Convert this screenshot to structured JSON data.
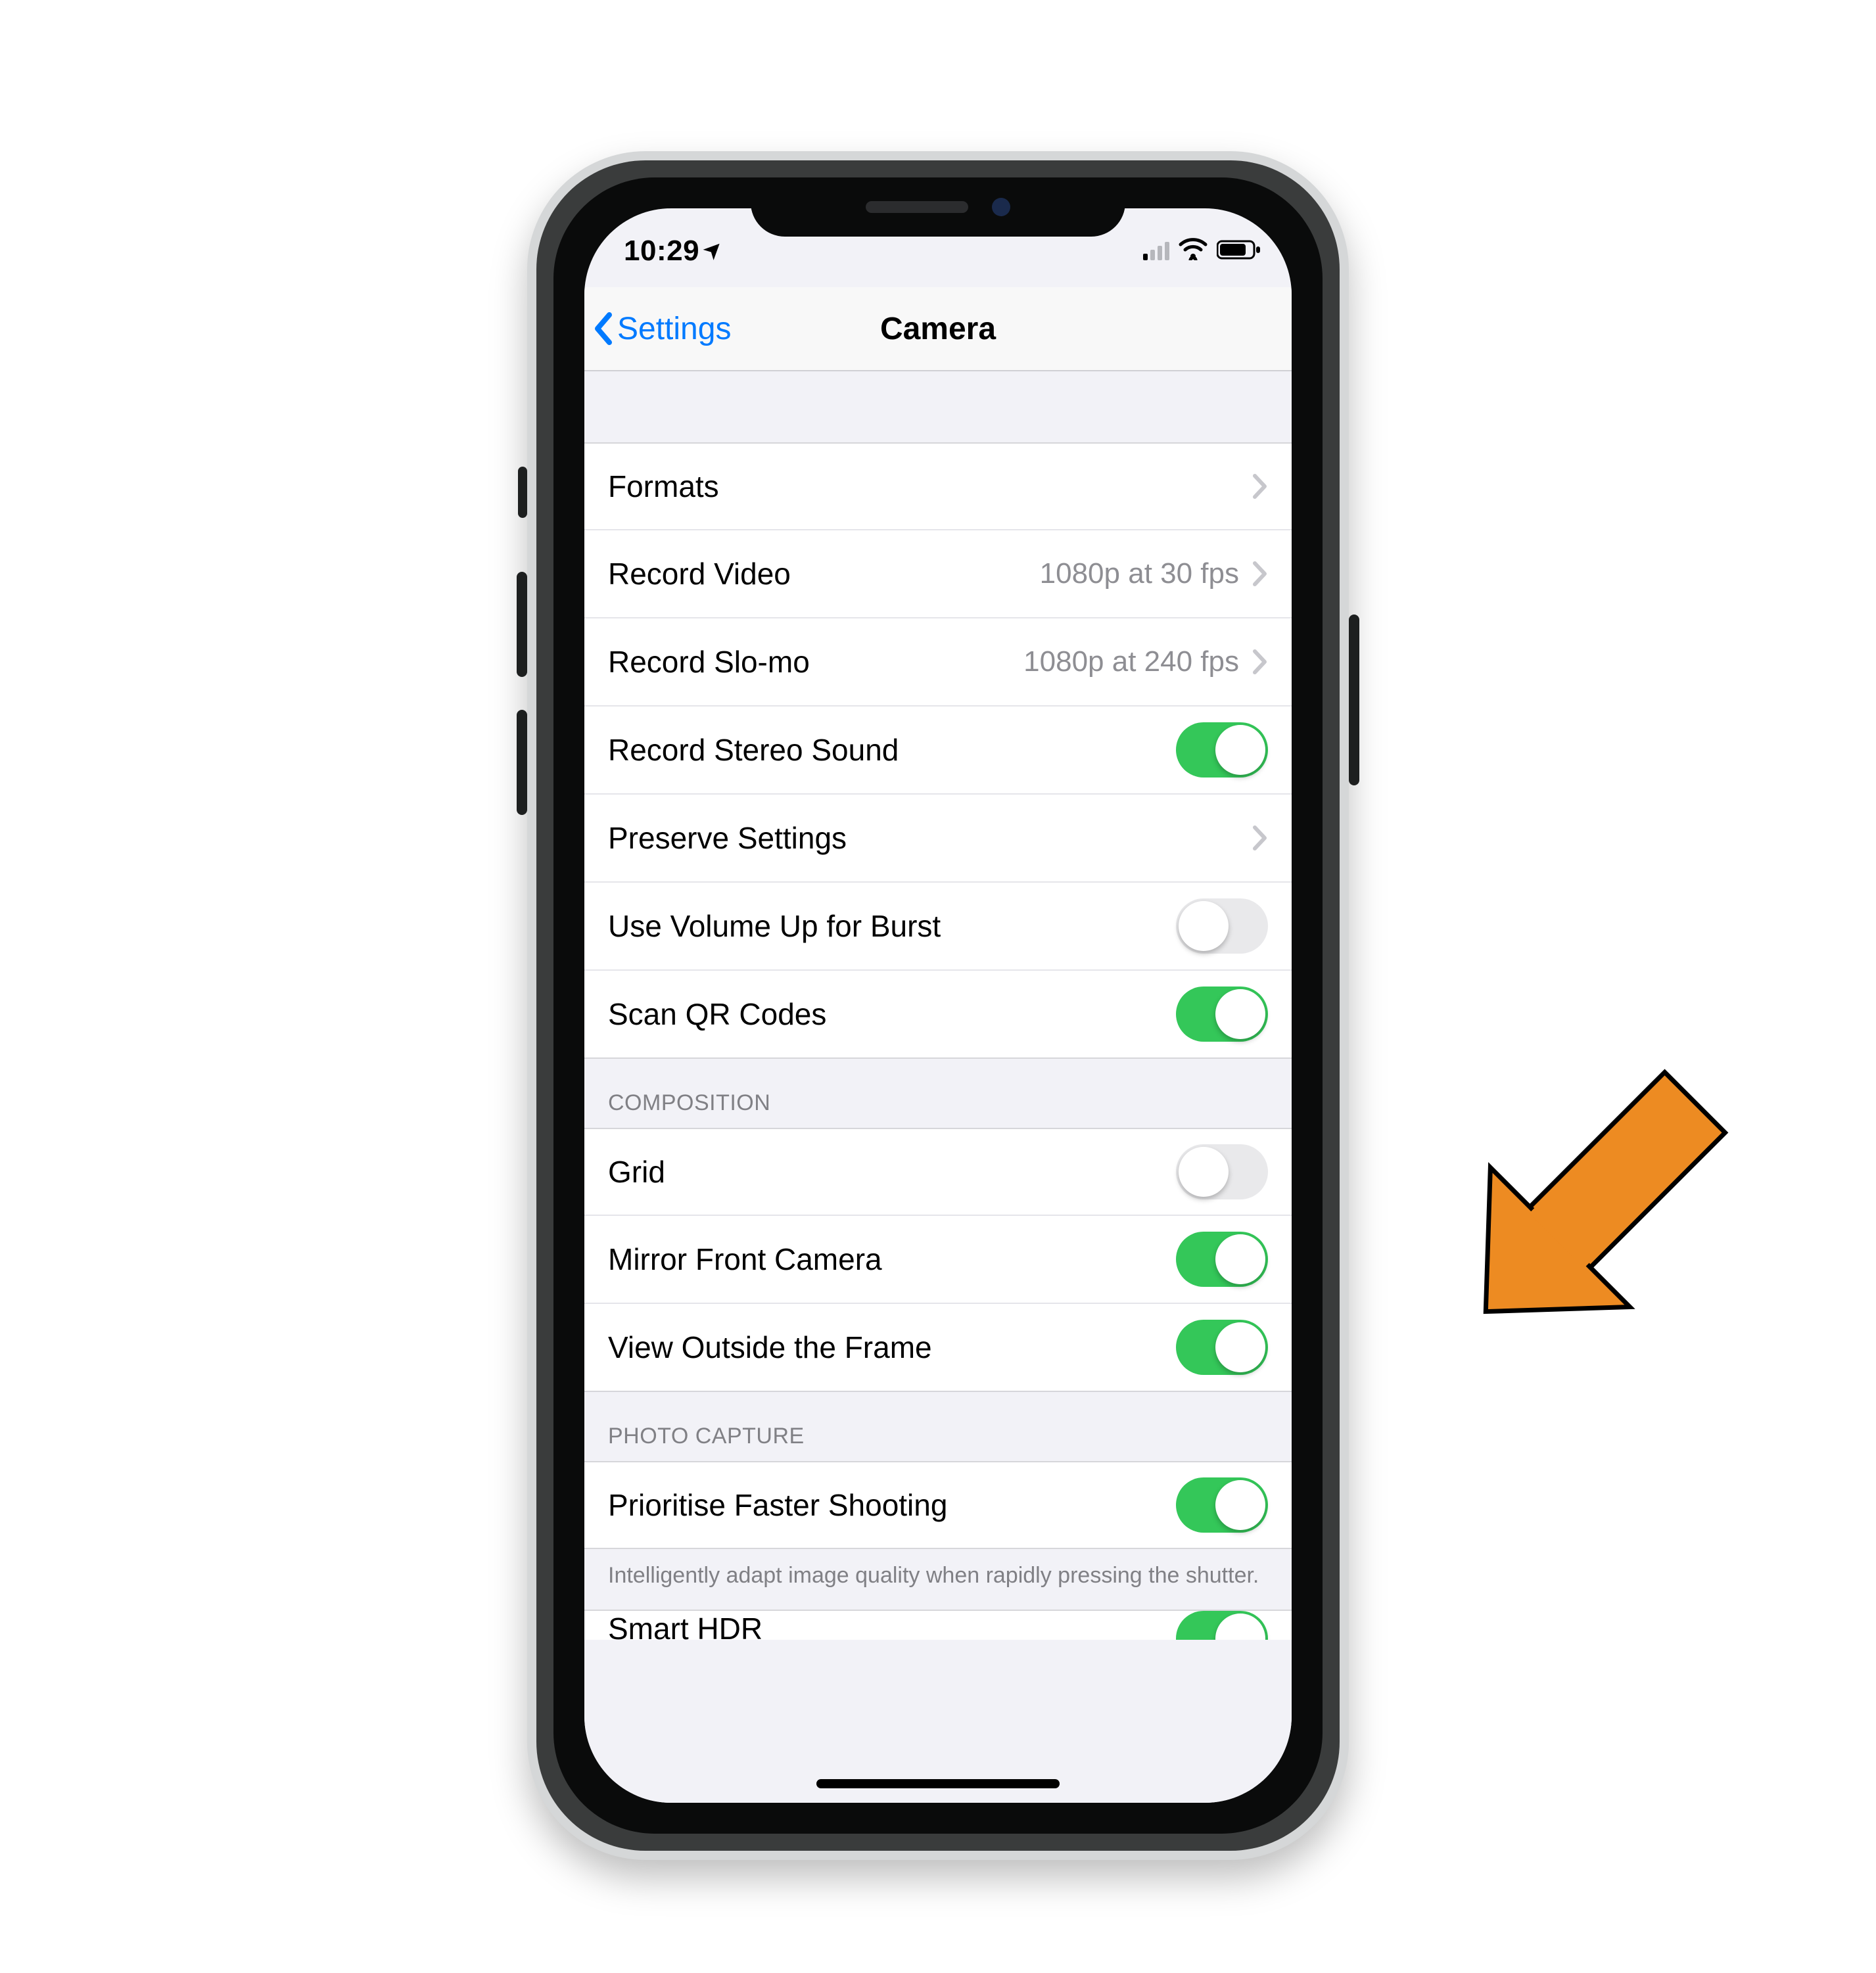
{
  "status_bar": {
    "time": "10:29",
    "location_glyph": "➤"
  },
  "nav": {
    "back_label": "Settings",
    "title": "Camera"
  },
  "group1": {
    "formats": {
      "label": "Formats"
    },
    "record_video": {
      "label": "Record Video",
      "value": "1080p at 30 fps"
    },
    "record_slomo": {
      "label": "Record Slo-mo",
      "value": "1080p at 240 fps"
    },
    "stereo": {
      "label": "Record Stereo Sound",
      "on": true
    },
    "preserve": {
      "label": "Preserve Settings"
    },
    "burst": {
      "label": "Use Volume Up for Burst",
      "on": false
    },
    "qr": {
      "label": "Scan QR Codes",
      "on": true
    }
  },
  "group2": {
    "header": "COMPOSITION",
    "grid": {
      "label": "Grid",
      "on": false
    },
    "mirror": {
      "label": "Mirror Front Camera",
      "on": true
    },
    "outside": {
      "label": "View Outside the Frame",
      "on": true
    }
  },
  "group3": {
    "header": "PHOTO CAPTURE",
    "faster": {
      "label": "Prioritise Faster Shooting",
      "on": true
    },
    "footer": "Intelligently adapt image quality when rapidly pressing the shutter."
  },
  "group4": {
    "smart_hdr": {
      "label": "Smart HDR",
      "on": true
    }
  }
}
